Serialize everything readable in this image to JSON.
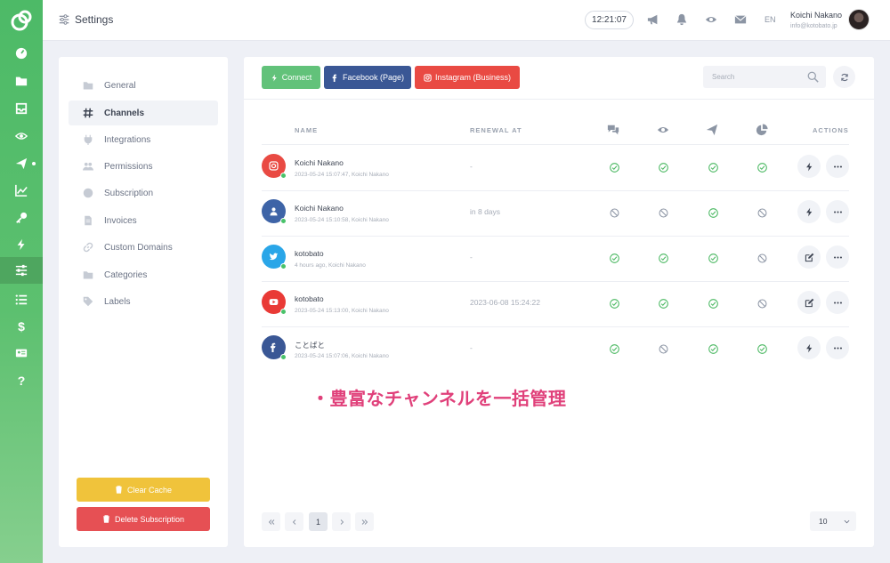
{
  "header": {
    "title": "Settings",
    "clock": "12:21:07",
    "language": "EN",
    "user_name": "Koichi Nakano",
    "user_email": "info@kotobato.jp"
  },
  "rail": {
    "items": [
      "dashboard-icon",
      "folder-icon",
      "inbox-icon",
      "eye-icon",
      "send-icon",
      "chart-icon",
      "key-icon",
      "bolt-icon",
      "sliders-icon",
      "list-icon",
      "dollar-icon",
      "id-card-icon",
      "help-icon"
    ],
    "active": "sliders-icon"
  },
  "sidebar": {
    "items": [
      {
        "label": "General",
        "icon": "folder-icon"
      },
      {
        "label": "Channels",
        "icon": "hash-icon",
        "active": true
      },
      {
        "label": "Integrations",
        "icon": "plug-icon"
      },
      {
        "label": "Permissions",
        "icon": "users-icon"
      },
      {
        "label": "Subscription",
        "icon": "badge-icon"
      },
      {
        "label": "Invoices",
        "icon": "document-icon"
      },
      {
        "label": "Custom Domains",
        "icon": "link-icon"
      },
      {
        "label": "Categories",
        "icon": "folder-icon"
      },
      {
        "label": "Labels",
        "icon": "tag-icon"
      }
    ],
    "clear_cache": "Clear Cache",
    "delete_subscription": "Delete Subscription"
  },
  "toolbar": {
    "connect": "Connect",
    "facebook": "Facebook (Page)",
    "instagram": "Instagram (Business)",
    "search_placeholder": "Search"
  },
  "table": {
    "columns": {
      "name": "NAME",
      "renewal": "RENEWAL AT",
      "messages_icon": "comments-icon",
      "view_icon": "eye-icon",
      "send_icon": "paper-plane-icon",
      "stats_icon": "pie-chart-icon",
      "actions": "ACTIONS"
    },
    "rows": [
      {
        "name": "Koichi Nakano",
        "meta": "2023-05-24 15:07:47, Koichi Nakano",
        "renewal": "-",
        "platform": "instagram",
        "color": "#e94a43",
        "status": [
          "ok",
          "ok",
          "ok",
          "ok"
        ],
        "action_icon": "bolt-icon"
      },
      {
        "name": "Koichi Nakano",
        "meta": "2023-05-24 15:10:58, Koichi Nakano",
        "renewal": "in 8 days",
        "platform": "facebook-user",
        "color": "#3e64a7",
        "status": [
          "no",
          "no",
          "ok",
          "no"
        ],
        "action_icon": "bolt-icon"
      },
      {
        "name": "kotobato",
        "meta": "4 hours ago, Koichi Nakano",
        "renewal": "-",
        "platform": "twitter",
        "color": "#2aa6e8",
        "status": [
          "ok",
          "ok",
          "ok",
          "no"
        ],
        "action_icon": "edit-icon"
      },
      {
        "name": "kotobato",
        "meta": "2023-05-24 15:13:00, Koichi Nakano",
        "renewal": "2023-06-08 15:24:22",
        "platform": "youtube",
        "color": "#e93a36",
        "status": [
          "ok",
          "ok",
          "ok",
          "no"
        ],
        "action_icon": "edit-icon"
      },
      {
        "name": "ことばと",
        "meta": "2023-05-24 15:07:06, Koichi Nakano",
        "renewal": "-",
        "platform": "facebook",
        "color": "#3a5795",
        "status": [
          "ok",
          "no",
          "ok",
          "ok"
        ],
        "action_icon": "bolt-icon"
      }
    ]
  },
  "annotation": "・豊富なチャンネルを一括管理",
  "pagination": {
    "current": "1",
    "per_page": "10"
  }
}
